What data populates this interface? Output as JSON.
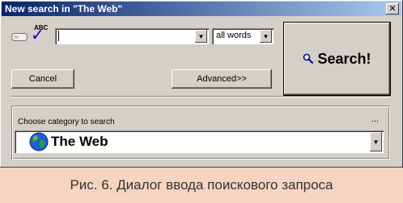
{
  "window": {
    "title": "New search in \"The Web\"",
    "close_label": "✕"
  },
  "search": {
    "query": "",
    "mode_selected": "all words",
    "spell_label": "ABC"
  },
  "buttons": {
    "cancel": "Cancel",
    "advanced": "Advanced>>",
    "search": "Search!"
  },
  "category": {
    "label": "Choose category to search",
    "more": "...",
    "selected": "The Web"
  },
  "caption": "Рис. 6. Диалог ввода поискового запроса",
  "colors": {
    "titlebar_start": "#0a246a",
    "titlebar_end": "#a6caf0",
    "face": "#d4d0c8",
    "caption_bg": "#f6d5c0"
  }
}
